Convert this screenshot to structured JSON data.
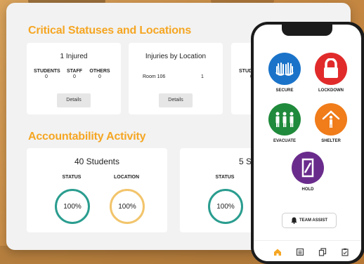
{
  "critical": {
    "title": "Critical Statuses and Locations",
    "injured_card": {
      "title": "1 Injured",
      "stats": [
        {
          "label": "STUDENTS",
          "value": "0"
        },
        {
          "label": "STAFF",
          "value": "0"
        },
        {
          "label": "OTHERS",
          "value": "0"
        }
      ],
      "button": "Details"
    },
    "location_card": {
      "title": "Injuries by Location",
      "rows": [
        {
          "location": "Room 106",
          "count": "1"
        }
      ],
      "button": "Details"
    },
    "partial_card": {
      "stat_partial": "STUD",
      "value_partial": "0"
    }
  },
  "accountability": {
    "title": "Accountability Activity",
    "cards": [
      {
        "title": "40 Students",
        "status_label": "STATUS",
        "status_value": "100%",
        "location_label": "LOCATION",
        "location_value": "100%"
      },
      {
        "title": "5 St",
        "status_label": "STATUS",
        "status_value": "100%"
      }
    ]
  },
  "phone": {
    "actions": [
      {
        "label": "SECURE",
        "color": "#1a73c9",
        "icon": "hands-icon"
      },
      {
        "label": "LOCKDOWN",
        "color": "#e12b2b",
        "icon": "padlock-icon"
      },
      {
        "label": "EVACUATE",
        "color": "#1f8a3b",
        "icon": "people-icon"
      },
      {
        "label": "SHELTER",
        "color": "#f07c1a",
        "icon": "house-person-icon"
      },
      {
        "label": "HOLD",
        "color": "#6a2c8c",
        "icon": "door-icon"
      }
    ],
    "team_assist": "TEAM ASSIST",
    "tabs": [
      "home-icon",
      "list-icon",
      "copy-icon",
      "checklist-icon"
    ],
    "active_tab_color": "#f5a623"
  }
}
